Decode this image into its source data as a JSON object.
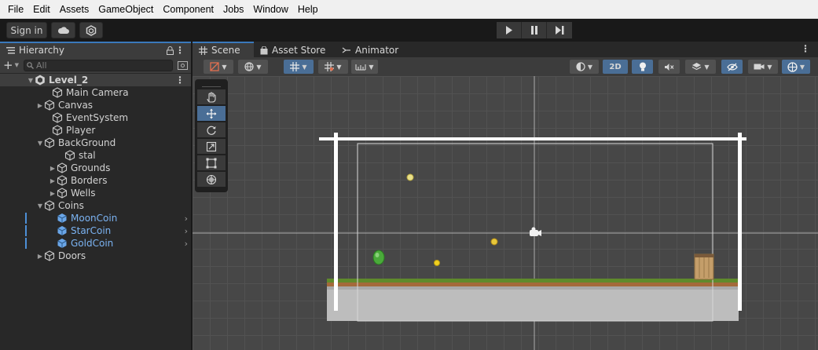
{
  "menu": [
    "File",
    "Edit",
    "Assets",
    "GameObject",
    "Component",
    "Jobs",
    "Window",
    "Help"
  ],
  "toolbar": {
    "sign_in_label": "Sign in"
  },
  "hierarchy": {
    "tab_label": "Hierarchy",
    "search_placeholder": "All",
    "scene_name": "Level_2",
    "items": [
      {
        "label": "Main Camera"
      },
      {
        "label": "Canvas"
      },
      {
        "label": "EventSystem"
      },
      {
        "label": "Player"
      },
      {
        "label": "BackGround"
      },
      {
        "label": "stal"
      },
      {
        "label": "Grounds"
      },
      {
        "label": "Borders"
      },
      {
        "label": "Wells"
      },
      {
        "label": "Coins"
      },
      {
        "label": "MoonCoin"
      },
      {
        "label": "StarCoin"
      },
      {
        "label": "GoldCoin"
      },
      {
        "label": "Doors"
      }
    ]
  },
  "scene_tabs": [
    {
      "label": "Scene"
    },
    {
      "label": "Asset Store"
    },
    {
      "label": "Animator"
    }
  ],
  "scene_toolbar": {
    "mode_2d_label": "2D"
  },
  "colors": {
    "accent": "#4a6e96",
    "prefab_text": "#7bb3f2",
    "tab_highlight": "#3a79bb"
  }
}
